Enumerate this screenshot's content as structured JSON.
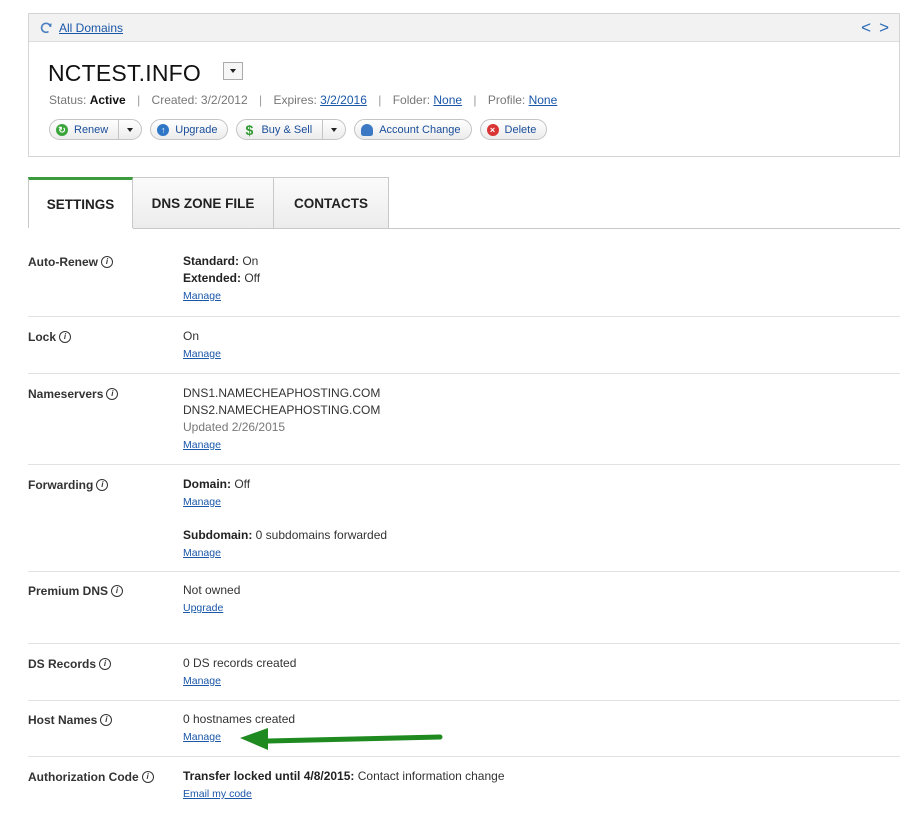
{
  "header": {
    "all_domains": "All Domains",
    "nav_prev": "<",
    "nav_next": ">",
    "domain": "NCTEST.INFO",
    "status_label": "Status:",
    "status_value": "Active",
    "created_label": "Created:",
    "created_value": "3/2/2012",
    "expires_label": "Expires:",
    "expires_value": "3/2/2016",
    "folder_label": "Folder:",
    "folder_value": "None",
    "profile_label": "Profile:",
    "profile_value": "None",
    "buttons": {
      "renew": "Renew",
      "upgrade": "Upgrade",
      "buy_sell": "Buy & Sell",
      "account_change": "Account Change",
      "delete": "Delete"
    }
  },
  "tabs": [
    "SETTINGS",
    "DNS ZONE FILE",
    "CONTACTS"
  ],
  "settings": {
    "auto_renew": {
      "label": "Auto-Renew",
      "standard_label": "Standard:",
      "standard_value": " On",
      "extended_label": "Extended:",
      "extended_value": " Off",
      "link": "Manage"
    },
    "lock": {
      "label": "Lock",
      "value": "On",
      "link": "Manage"
    },
    "nameservers": {
      "label": "Nameservers",
      "ns1": "DNS1.NAMECHEAPHOSTING.COM",
      "ns2": "DNS2.NAMECHEAPHOSTING.COM",
      "updated": "Updated 2/26/2015",
      "link": "Manage"
    },
    "forwarding": {
      "label": "Forwarding",
      "domain_label": "Domain:",
      "domain_value": " Off",
      "link1": "Manage",
      "subdomain_label": "Subdomain:",
      "subdomain_value": " 0 subdomains forwarded",
      "link2": "Manage"
    },
    "premium_dns": {
      "label": "Premium DNS",
      "value": "Not owned",
      "link": "Upgrade"
    },
    "ds_records": {
      "label": "DS Records",
      "value": "0 DS records created",
      "link": "Manage"
    },
    "host_names": {
      "label": "Host Names",
      "value": "0 hostnames created",
      "link": "Manage"
    },
    "auth_code": {
      "label": "Authorization Code",
      "locked_label": "Transfer locked until 4/8/2015:",
      "locked_value": " Contact information change",
      "link": "Email my code"
    }
  },
  "colors": {
    "accent_green": "#3c9b3c",
    "link_blue": "#1a57a8",
    "arrow_green": "#1f8a1f"
  },
  "icons": {
    "refresh": "refresh-icon",
    "info": "info-icon",
    "arrow": "pointer-arrow-icon"
  }
}
